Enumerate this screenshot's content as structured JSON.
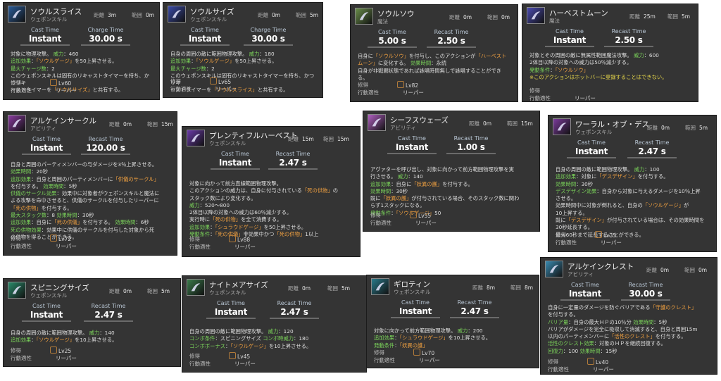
{
  "labels": {
    "cast": "Cast Time",
    "charge": "Charge Time",
    "recast": "Recast Time",
    "range": "距離",
    "radius": "範囲",
    "learned": "修得",
    "affinity": "行動適性",
    "role": "リーパー"
  },
  "cards": [
    {
      "id": "soul-slice",
      "name": "ソウルスライス",
      "cat": "ウェポンスキル",
      "range": "3m",
      "radius": "0m",
      "cast": "Instant",
      "t2": "30.00 s",
      "lv": "Lv60",
      "desc": [
        [
          {
            "t": "対象に物理攻撃。 "
          },
          {
            "t": "威力",
            "c": "g"
          },
          {
            "t": "：460"
          }
        ],
        [
          {
            "t": "追加効果",
            "c": "g"
          },
          {
            "t": "："
          },
          {
            "t": "「ソウルゲージ」",
            "c": "o"
          },
          {
            "t": "を50上昇させる。"
          }
        ],
        [
          {
            "t": "最大チャージ数",
            "c": "g"
          },
          {
            "t": "：2"
          }
        ],
        [
          {
            "t": "このウェポンスキルは固有のリキャストタイマーを持ち、かつリキ"
          }
        ],
        [
          {
            "t": "ャストタイマーを"
          },
          {
            "t": "「ソウルサイズ」",
            "c": "o"
          },
          {
            "t": "と共有する。"
          }
        ]
      ]
    },
    {
      "id": "soul-scythe",
      "name": "ソウルサイズ",
      "cat": "ウェポンスキル",
      "range": "0m",
      "radius": "5m",
      "cast": "Instant",
      "t2": "30.00 s",
      "lv": "Lv65",
      "desc": [
        [
          {
            "t": "自身の周囲の敵に範囲物理攻撃。 "
          },
          {
            "t": "威力",
            "c": "g"
          },
          {
            "t": "：180"
          }
        ],
        [
          {
            "t": "追加効果",
            "c": "g"
          },
          {
            "t": "："
          },
          {
            "t": "「ソウルゲージ」",
            "c": "o"
          },
          {
            "t": "を50上昇させる。"
          }
        ],
        [
          {
            "t": "最大チャージ数",
            "c": "g"
          },
          {
            "t": "：2"
          }
        ],
        [
          {
            "t": "このウェポンスキルは固有のリキャストタイマーを持ち、かつリキ"
          }
        ],
        [
          {
            "t": "ャストタイマーを"
          },
          {
            "t": "「ソウルスライス」",
            "c": "o"
          },
          {
            "t": "と共有する。"
          }
        ]
      ]
    },
    {
      "id": "soulsow",
      "name": "ソウルソウ",
      "cat": "魔法",
      "range": "0m",
      "radius": "0m",
      "cast": "5.00 s",
      "t2": "2.50 s",
      "lv": "Lv82",
      "desc": [
        [
          {
            "t": "自身に"
          },
          {
            "t": "「ソウルソウ」",
            "c": "o"
          },
          {
            "t": "を付与し、このアクションが"
          },
          {
            "t": "「ハーベスト",
            "c": "o"
          }
        ],
        [
          {
            "t": "ムーン」",
            "c": "o"
          },
          {
            "t": "に変化する。 "
          },
          {
            "t": "効果時間",
            "c": "g"
          },
          {
            "t": "：永続"
          }
        ],
        [
          {
            "t": "自身が非戦闘状態であれば詠唱時間無しで詠唱することができ"
          }
        ],
        [
          {
            "t": "る。"
          }
        ]
      ]
    },
    {
      "id": "harvest-moon",
      "name": "ハーベストムーン",
      "cat": "魔法",
      "range": "25m",
      "radius": "5m",
      "cast": "Instant",
      "t2": "2.50 s",
      "lv": "",
      "desc": [
        [
          {
            "t": "対象とその周囲の敵に無属性範囲魔法攻撃。 "
          },
          {
            "t": "威力",
            "c": "g"
          },
          {
            "t": "：600"
          }
        ],
        [
          {
            "t": "2体目以降の対象への威力は50％減少する。"
          }
        ],
        [
          {
            "t": "発動条件",
            "c": "g"
          },
          {
            "t": "："
          },
          {
            "t": "「ソウルソウ」",
            "c": "o"
          }
        ],
        [
          {
            "t": " "
          }
        ],
        [
          {
            "t": "※このアクションはホットバーに登録することはできない。",
            "c": "y"
          }
        ]
      ]
    },
    {
      "id": "arcane-circle",
      "name": "アルケインサークル",
      "cat": "アビリティ",
      "range": "0m",
      "radius": "15m",
      "cast": "Instant",
      "t2": "120.00 s",
      "lv": "Lv72",
      "desc": [
        [
          {
            "t": "自身と周囲のパーティメンバーの与ダメージを3％上昇させる。"
          }
        ],
        [
          {
            "t": "効果時間",
            "c": "g"
          },
          {
            "t": "：20秒"
          }
        ],
        [
          {
            "t": "追加効果",
            "c": "g"
          },
          {
            "t": "：自身と周囲のパーティメンバーに"
          },
          {
            "t": "「供儀のサークル」",
            "c": "o"
          }
        ],
        [
          {
            "t": "を付与する。 "
          },
          {
            "t": "効果時間",
            "c": "g"
          },
          {
            "t": "：5秒"
          }
        ],
        [
          {
            "t": "供儀のサークル効果",
            "c": "g"
          },
          {
            "t": "：効果中に対象者がウェポンスキルと魔法に"
          }
        ],
        [
          {
            "t": "よる攻撃を命中させると、供儀のサークルを付与したリーパーに"
          }
        ],
        [
          {
            "t": "「死の供物」",
            "c": "o"
          },
          {
            "t": "を付与する。"
          }
        ],
        [
          {
            "t": "最大スタック数",
            "c": "g"
          },
          {
            "t": "：8 "
          },
          {
            "t": "効果時間",
            "c": "g"
          },
          {
            "t": "：30秒"
          }
        ],
        [
          {
            "t": "追加効果",
            "c": "g"
          },
          {
            "t": "：自身に"
          },
          {
            "t": "「死の供儀」",
            "c": "o"
          },
          {
            "t": "を付与する。 "
          },
          {
            "t": "効果時間",
            "c": "g"
          },
          {
            "t": "：6秒"
          }
        ],
        [
          {
            "t": "死の供物効果",
            "c": "g"
          },
          {
            "t": "：効果中に供儀のサークルを付与した対象から死"
          }
        ],
        [
          {
            "t": "の供物を得ることができる。"
          }
        ]
      ]
    },
    {
      "id": "plentiful-harvest",
      "name": "プレンティフルハーベスト",
      "cat": "ウェポンスキル",
      "range": "15m",
      "radius": "15m",
      "cast": "Instant",
      "t2": "2.47 s",
      "lv": "Lv88",
      "desc": [
        [
          {
            "t": "対象に向かって前方直線範囲物理攻撃。"
          }
        ],
        [
          {
            "t": "このアクションの威力は、自身に付与されている"
          },
          {
            "t": "「死の供物」",
            "c": "o"
          },
          {
            "t": "の"
          }
        ],
        [
          {
            "t": "スタック数により変化する。"
          }
        ],
        [
          {
            "t": "威力",
            "c": "g"
          },
          {
            "t": "：520～800"
          }
        ],
        [
          {
            "t": "2体目以降の対象への威力は60％減少する。"
          }
        ],
        [
          {
            "t": "実行時に"
          },
          {
            "t": "「死の供物」",
            "c": "o"
          },
          {
            "t": "を全て消費する。"
          }
        ],
        [
          {
            "t": "追加効果",
            "c": "g"
          },
          {
            "t": "："
          },
          {
            "t": "「シュラウドゲージ」",
            "c": "o"
          },
          {
            "t": "を50上昇させる。"
          }
        ],
        [
          {
            "t": "発動条件",
            "c": "g"
          },
          {
            "t": "："
          },
          {
            "t": "「死の供儀」",
            "c": "o"
          },
          {
            "t": "非効果中かつ"
          },
          {
            "t": "「死の供物」",
            "c": "o"
          },
          {
            "t": "1以上"
          }
        ]
      ]
    },
    {
      "id": "gibbet-like",
      "name": "シーフスウェーズ",
      "cat": "アビリティ",
      "range": "0m",
      "radius": "15m",
      "cast": "Instant",
      "t2": "1.00 s",
      "lv": "Lv55",
      "desc": [
        [
          {
            "t": "アヴァターを呼び出し、対象に向かって前方範囲物理攻撃を実"
          }
        ],
        [
          {
            "t": "行させる。 "
          },
          {
            "t": "威力",
            "c": "g"
          },
          {
            "t": "：140"
          }
        ],
        [
          {
            "t": "追加効果",
            "c": "g"
          },
          {
            "t": "：自身に"
          },
          {
            "t": "「妖異の護」",
            "c": "o"
          },
          {
            "t": "を付与する。"
          }
        ],
        [
          {
            "t": "効果時間",
            "c": "g"
          },
          {
            "t": "：30秒"
          }
        ],
        [
          {
            "t": "既に"
          },
          {
            "t": "「妖異の護」",
            "c": "o"
          },
          {
            "t": "が付与されている場合、そのスタック数に関わ"
          }
        ],
        [
          {
            "t": "らず1スタックになる。"
          }
        ],
        [
          {
            "t": "発動条件",
            "c": "g"
          },
          {
            "t": "："
          },
          {
            "t": "「ソウルゲージ」",
            "c": "o"
          },
          {
            "t": "50"
          }
        ]
      ]
    },
    {
      "id": "whorl-of-death",
      "name": "ワーラル・オブ・デス",
      "cat": "ウェポンスキル",
      "range": "0m",
      "radius": "5m",
      "cast": "Instant",
      "t2": "2.47 s",
      "lv": "Lv35",
      "desc": [
        [
          {
            "t": "自身の周囲の敵に範囲物理攻撃。 "
          },
          {
            "t": "威力",
            "c": "g"
          },
          {
            "t": "：100"
          }
        ],
        [
          {
            "t": "追加効果",
            "c": "g"
          },
          {
            "t": "：対象に"
          },
          {
            "t": "「デスデザイン」",
            "c": "o"
          },
          {
            "t": "を付与する。"
          }
        ],
        [
          {
            "t": "効果時間",
            "c": "g"
          },
          {
            "t": "：30秒"
          }
        ],
        [
          {
            "t": "デスデザイン効果",
            "c": "g"
          },
          {
            "t": "：自身から対象に与えるダメージを10％上昇"
          }
        ],
        [
          {
            "t": "させる。"
          }
        ],
        [
          {
            "t": "効果時間中に対象が倒れると、自身の"
          },
          {
            "t": "「ソウルゲージ」",
            "c": "o"
          },
          {
            "t": "が"
          }
        ],
        [
          {
            "t": "10上昇する。"
          }
        ],
        [
          {
            "t": "既に"
          },
          {
            "t": "「デスデザイン」",
            "c": "o"
          },
          {
            "t": "が付与されている場合は、その効果時間を"
          }
        ],
        [
          {
            "t": "30秒延長する。"
          }
        ],
        [
          {
            "t": "最大60秒まで延長することができる。"
          }
        ]
      ]
    },
    {
      "id": "spinning-scythe",
      "name": "スピニングサイズ",
      "cat": "ウェポンスキル",
      "range": "0m",
      "radius": "5m",
      "cast": "Instant",
      "t2": "2.47 s",
      "lv": "Lv25",
      "desc": [
        [
          {
            "t": "自身の周囲の敵に範囲物理攻撃。 "
          },
          {
            "t": "威力",
            "c": "g"
          },
          {
            "t": "：140"
          }
        ],
        [
          {
            "t": "追加効果",
            "c": "g"
          },
          {
            "t": "："
          },
          {
            "t": "「ソウルゲージ」",
            "c": "o"
          },
          {
            "t": "を10上昇させる。"
          }
        ]
      ]
    },
    {
      "id": "nightmare-scythe",
      "name": "ナイトメアサイズ",
      "cat": "ウェポンスキル",
      "range": "0m",
      "radius": "5m",
      "cast": "Instant",
      "t2": "2.47 s",
      "lv": "Lv45",
      "desc": [
        [
          {
            "t": "自身の周囲の敵に範囲物理攻撃。 "
          },
          {
            "t": "威力",
            "c": "g"
          },
          {
            "t": "：120"
          }
        ],
        [
          {
            "t": "コンボ条件",
            "c": "g"
          },
          {
            "t": "：スピニングサイズ "
          },
          {
            "t": "コンボ時威力",
            "c": "g"
          },
          {
            "t": "：180"
          }
        ],
        [
          {
            "t": "コンボボーナス",
            "c": "g"
          },
          {
            "t": "："
          },
          {
            "t": "「ソウルゲージ」",
            "c": "o"
          },
          {
            "t": "を10上昇させる。"
          }
        ]
      ]
    },
    {
      "id": "guillotine",
      "name": "ギロティン",
      "cat": "ウェポンスキル",
      "range": "8m",
      "radius": "8m",
      "cast": "Instant",
      "t2": "2.47 s",
      "lv": "Lv70",
      "desc": [
        [
          {
            "t": "対象に向かって前方範囲物理攻撃。 "
          },
          {
            "t": "威力",
            "c": "g"
          },
          {
            "t": "：200"
          }
        ],
        [
          {
            "t": "追加効果",
            "c": "g"
          },
          {
            "t": "："
          },
          {
            "t": "「シュラウドゲージ」",
            "c": "o"
          },
          {
            "t": "を10上昇させる。"
          }
        ],
        [
          {
            "t": "発動条件",
            "c": "g"
          },
          {
            "t": "："
          },
          {
            "t": "「妖異の護」",
            "c": "o"
          }
        ]
      ]
    },
    {
      "id": "arcane-crest",
      "name": "アルケインクレスト",
      "cat": "アビリティ",
      "range": "0m",
      "radius": "0m",
      "cast": "Instant",
      "t2": "30.00 s",
      "lv": "Lv40",
      "desc": [
        [
          {
            "t": "自身に一定量のダメージを防ぐバリアである"
          },
          {
            "t": "「守護のクレスト」",
            "c": "o"
          }
        ],
        [
          {
            "t": "を付与する。"
          }
        ],
        [
          {
            "t": "バリア量",
            "c": "g"
          },
          {
            "t": "：自身の最大ＨＰの10％分 "
          },
          {
            "t": "効果時間",
            "c": "g"
          },
          {
            "t": "：5秒"
          }
        ],
        [
          {
            "t": "バリアがダメージを完全に吸収して消滅すると、自身と周囲15m"
          }
        ],
        [
          {
            "t": "以内のパーティメンバーに"
          },
          {
            "t": "「活性のクレスト」",
            "c": "o"
          },
          {
            "t": "を付与する。"
          }
        ],
        [
          {
            "t": "活性のクレスト効果",
            "c": "g"
          },
          {
            "t": "：対象のＨＰを継続回復する。"
          }
        ],
        [
          {
            "t": "回復力",
            "c": "g"
          },
          {
            "t": "：100 "
          },
          {
            "t": "効果時間",
            "c": "g"
          },
          {
            "t": "：15秒"
          }
        ]
      ]
    }
  ]
}
